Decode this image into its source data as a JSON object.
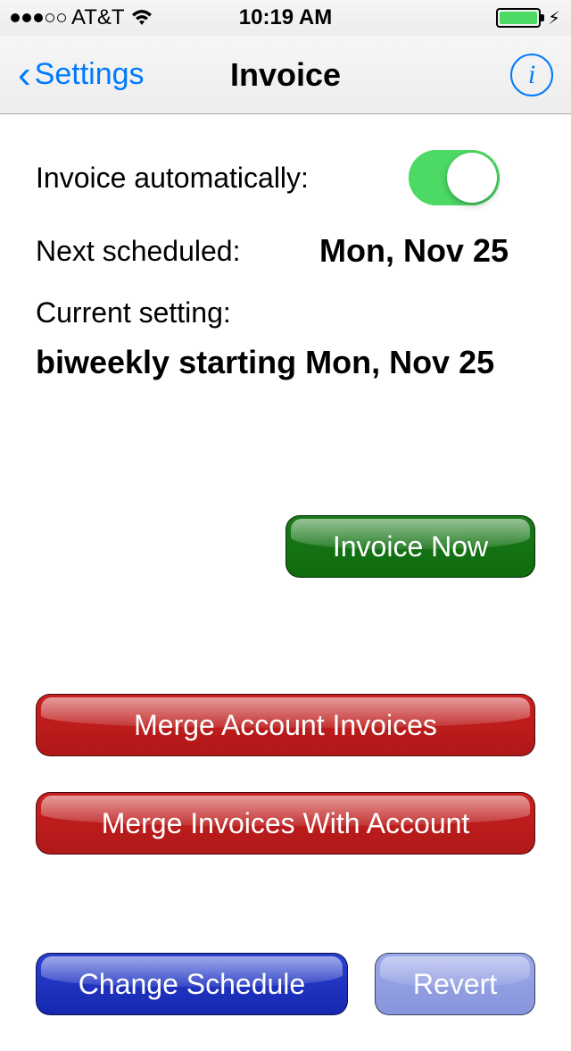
{
  "status": {
    "carrier": "AT&T",
    "time": "10:19 AM"
  },
  "nav": {
    "back_label": "Settings",
    "title": "Invoice"
  },
  "settings": {
    "auto_label": "Invoice automatically:",
    "next_label": "Next scheduled:",
    "next_value": "Mon, Nov 25",
    "current_label": "Current setting:",
    "schedule_value": "biweekly starting Mon, Nov 25"
  },
  "buttons": {
    "invoice_now": "Invoice Now",
    "merge_account": "Merge Account Invoices",
    "merge_with": "Merge Invoices With Account",
    "change_schedule": "Change Schedule",
    "revert": "Revert"
  }
}
